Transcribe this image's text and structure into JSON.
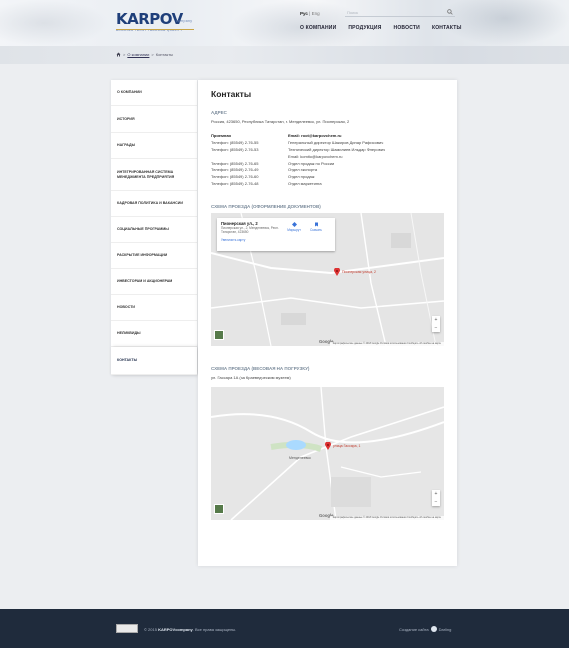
{
  "header": {
    "logo_text": "KARPOV",
    "logo_small": "company",
    "logo_tagline": "BUILDING TRUST THROUGH QUALITY",
    "lang_active": "Рус",
    "lang_sep": " | ",
    "lang_other": "Eng",
    "search_placeholder": "Поиск",
    "nav": [
      "О КОМПАНИИ",
      "ПРОДУКЦИЯ",
      "НОВОСТИ",
      "КОНТАКТЫ"
    ]
  },
  "breadcrumb": {
    "sep1": " > ",
    "link": "О компании",
    "sep2": " > ",
    "current": "Контакты"
  },
  "sidebar": {
    "items": [
      "О компании",
      "История",
      "Награды",
      "Интегрированная система менеджмента предприятия",
      "Кадровая политика и вакансии",
      "Социальные программы",
      "Раскрытие информации",
      "Инвесторам и акционерам",
      "Новости",
      "Неликвиды",
      "Контакты"
    ],
    "active_index": 10
  },
  "main": {
    "title": "Контакты",
    "address_title": "АДРЕС",
    "address": "Россия, 423650, Республика Татарстан, г. Менделеевск, ул. Пионерская, 2",
    "contacts_left": [
      "Приемная",
      "Телефон: (85549) 2-76-55",
      "Телефон: (85549) 2-76-53",
      "",
      "Телефон: (85549) 2-76-65",
      "Телефон: (85549) 2-76-49",
      "Телефон: (85549) 2-76-60",
      "Телефон: (85549) 2-76-48"
    ],
    "contacts_right": [
      "Email: root@karpovchem.ru",
      "Генеральный директор Шакиров Динар Рафисович",
      "Технический директор Шамилиев Ильдар Флерович",
      "Email: komito@karpovchem.ru",
      "Отдел продаж по России",
      "Отдел экспорта",
      "Отдел продаж",
      "Отдел маркетинга"
    ],
    "map1_title": "СХЕМА ПРОЕЗДА (ОФОРМЛЕНИЕ ДОКУМЕНТОВ)",
    "map1": {
      "card_title": "Пионерская ул., 2",
      "card_sub": "Пионерская ул., 2, Менделеевск, Респ. Татарстан, 423650",
      "card_link": "Увеличить карту",
      "btn1": "Маршрут",
      "btn2": "Скачать",
      "pin_label": "Пионерская улица, 2",
      "footer": "Картографические данные © 2018 Google   Условия использования   Сообщить об ошибке на карте"
    },
    "map2_title": "СХЕМА ПРОЕЗДА (ВЕСОВАЯ НА ПОГРУЗКУ)",
    "map2_note": "ул. Гассара 1А (за Краеведческим музеем)",
    "map2": {
      "town_label": "Менделеевск",
      "pin_label": "улица Гассара, 1",
      "footer": "Картографические данные © 2018 Google   Условия использования   Сообщить об ошибке на карте"
    },
    "google": "Google"
  },
  "footer": {
    "copy_prefix": "© 2015 ",
    "copy_brand": "KARPOVcompany",
    "copy_suffix": ". Все права защищены.",
    "made_by": "Создание сайта",
    "studio": "Darling"
  }
}
